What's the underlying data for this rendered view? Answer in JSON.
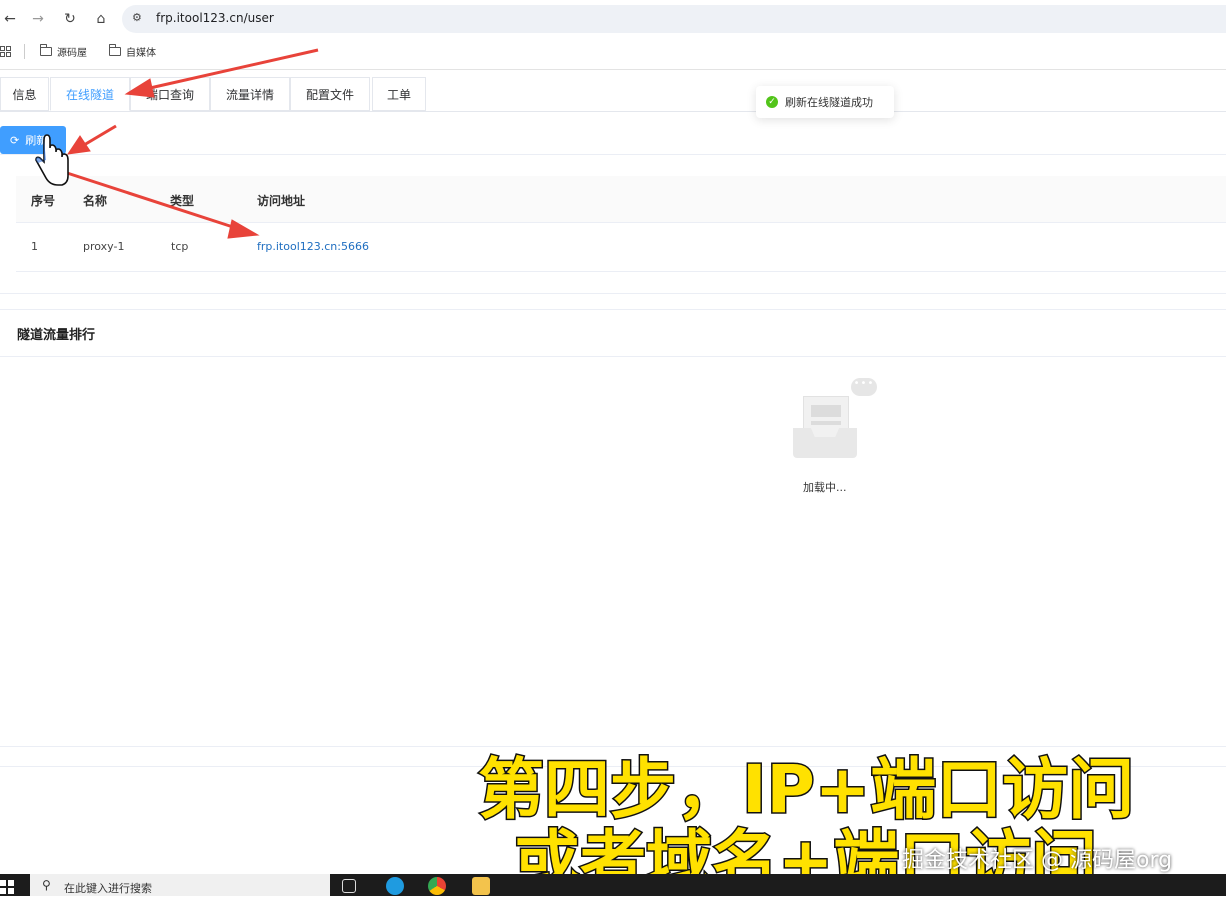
{
  "browser": {
    "url": "frp.itool123.cn/user",
    "bookmarks": [
      {
        "label": "源码屋"
      },
      {
        "label": "自媒体"
      }
    ]
  },
  "tabs": [
    {
      "label": "信息"
    },
    {
      "label": "在线隧道",
      "active": true
    },
    {
      "label": "端口查询"
    },
    {
      "label": "流量详情"
    },
    {
      "label": "配置文件"
    },
    {
      "label": "工单"
    }
  ],
  "toast": {
    "message": "刷新在线隧道成功"
  },
  "refresh_label": "刷新",
  "table": {
    "headers": [
      "序号",
      "名称",
      "类型",
      "访问地址"
    ],
    "rows": [
      {
        "index": "1",
        "name": "proxy-1",
        "type": "tcp",
        "address": "frp.itool123.cn:5666"
      }
    ]
  },
  "ranking": {
    "title": "隧道流量排行",
    "loading": "加载中..."
  },
  "caption": {
    "line1": "第四步，IP+端口访问",
    "line2": "或者域名+端口访问",
    "watermark": "掘金技术社区 @ 源码屋org"
  },
  "taskbar": {
    "search_placeholder": "在此键入进行搜索"
  },
  "colors": {
    "primary": "#409eff",
    "success": "#52c41a",
    "caption": "#ffe100",
    "arrow": "#e8433a"
  }
}
